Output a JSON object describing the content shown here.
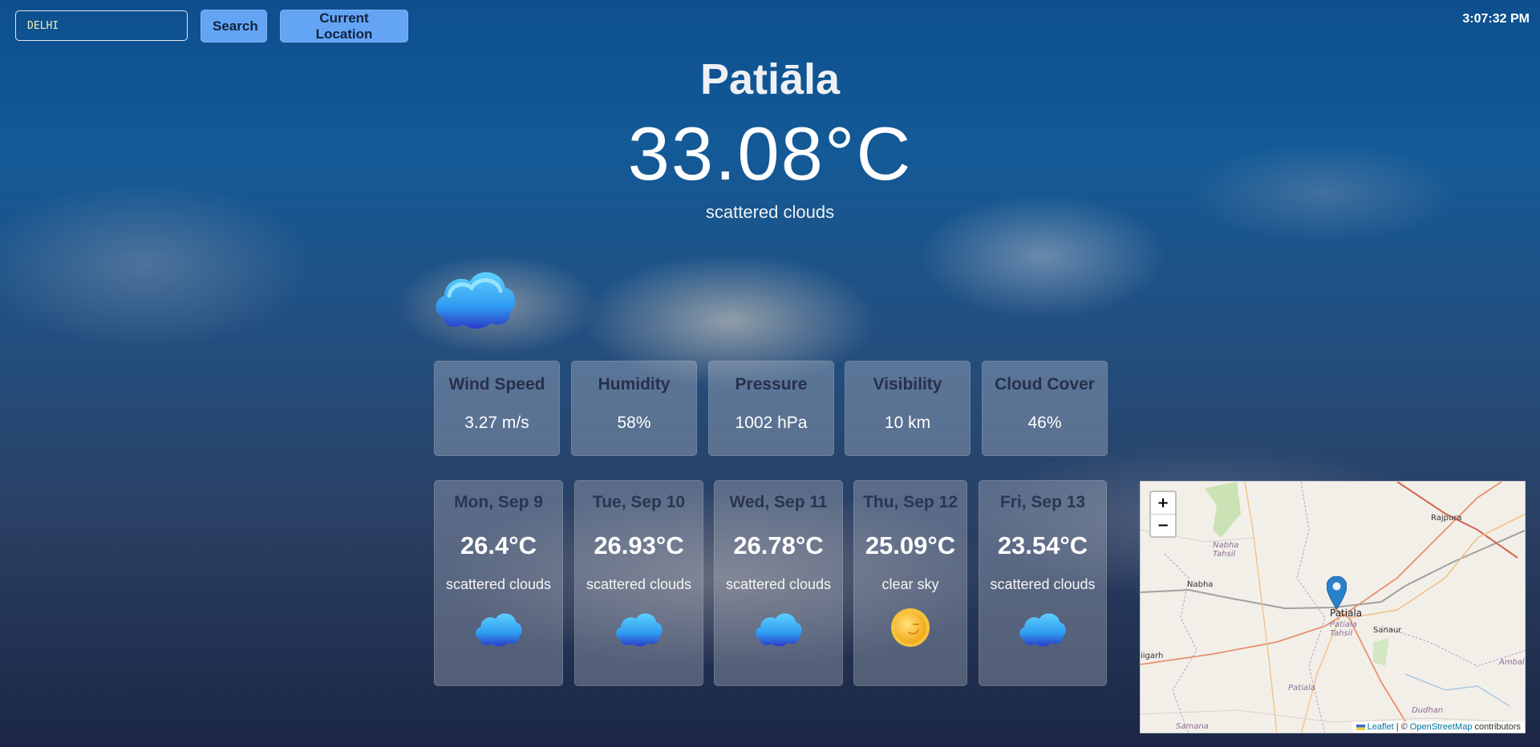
{
  "search": {
    "value": "DELHI",
    "placeholder": ""
  },
  "buttons": {
    "search": "Search",
    "current_location": "Current Location"
  },
  "clock": "3:07:32 PM",
  "current": {
    "city": "Patiāla",
    "temperature": "33.08°C",
    "condition": "scattered clouds",
    "icon": "cloud-icon"
  },
  "stats": [
    {
      "label": "Wind Speed",
      "value": "3.27 m/s"
    },
    {
      "label": "Humidity",
      "value": "58%"
    },
    {
      "label": "Pressure",
      "value": "1002 hPa"
    },
    {
      "label": "Visibility",
      "value": "10 km"
    },
    {
      "label": "Cloud Cover",
      "value": "46%"
    }
  ],
  "forecast": [
    {
      "day": "Mon, Sep 9",
      "temp": "26.4°C",
      "desc": "scattered clouds",
      "icon": "cloud-icon"
    },
    {
      "day": "Tue, Sep 10",
      "temp": "26.93°C",
      "desc": "scattered clouds",
      "icon": "cloud-icon"
    },
    {
      "day": "Wed, Sep 11",
      "temp": "26.78°C",
      "desc": "scattered clouds",
      "icon": "cloud-icon"
    },
    {
      "day": "Thu, Sep 12",
      "temp": "25.09°C",
      "desc": "clear sky",
      "icon": "sun-icon"
    },
    {
      "day": "Fri, Sep 13",
      "temp": "23.54°C",
      "desc": "scattered clouds",
      "icon": "cloud-icon"
    }
  ],
  "map": {
    "zoom_in": "+",
    "zoom_out": "−",
    "attribution_leaflet": "Leaflet",
    "attribution_sep": "| ©",
    "attribution_osm": "OpenStreetMap",
    "attribution_tail": "contributors",
    "labels": {
      "patiala": "Patiala",
      "patiala_tahsil": "Patiala Tahsil",
      "patiala_district": "Patiala",
      "sanaur": "Sanaur",
      "nabha": "Nabha",
      "nabha_tahsil": "Nabha Tahsil",
      "rajpura": "Rajpura",
      "garh": "iigarh",
      "ambala": "Ambala",
      "dudhan": "Dudhan",
      "samana": "Samana"
    }
  },
  "colors": {
    "button_bg": "#64a4f4",
    "card_bg": "rgba(190,195,205,0.35)",
    "map_marker": "#2a81cb"
  }
}
